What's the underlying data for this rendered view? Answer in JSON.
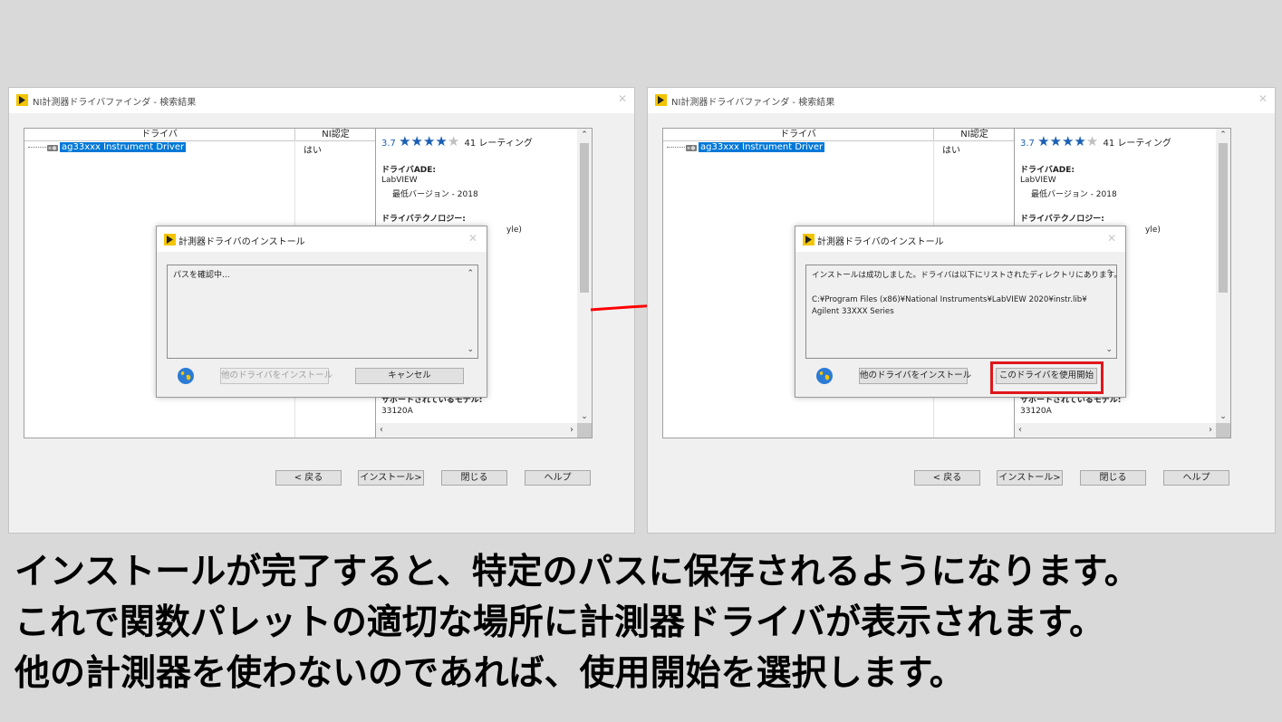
{
  "left_window": {
    "title": "NI計測器ドライバファインダ - 検索結果",
    "close_glyph": "✕",
    "list": {
      "col_driver": "ドライバ",
      "col_ni": "NI認定",
      "row_name": "ag33xxx Instrument Driver",
      "row_ni": "はい"
    },
    "details": {
      "rating_value": "3.7",
      "stars_filled": "★★★★",
      "stars_empty": "★",
      "rating_count": "41 レーティング",
      "ade_label": "ドライバADE:",
      "ade_value": "LabVIEW",
      "min_version": "最低バージョン - 2018",
      "tech_label": "ドライバテクノロジー:",
      "tech_partial": "yle)",
      "models_label": "サポートされているモデル:",
      "model": "33120A"
    },
    "buttons": {
      "back": "< 戻る",
      "install": "インストール>",
      "close": "閉じる",
      "help": "ヘルプ"
    },
    "dialog": {
      "title": "計測器ドライバのインストール",
      "message": "パスを確認中...",
      "other_button": "他のドライバをインストール",
      "cancel_button": "キャンセル"
    }
  },
  "right_window": {
    "title": "NI計測器ドライバファインダ - 検索結果",
    "close_glyph": "✕",
    "list": {
      "col_driver": "ドライバ",
      "col_ni": "NI認定",
      "row_name": "ag33xxx Instrument Driver",
      "row_ni": "はい"
    },
    "details": {
      "rating_value": "3.7",
      "stars_filled": "★★★★",
      "stars_empty": "★",
      "rating_count": "41 レーティング",
      "ade_label": "ドライバADE:",
      "ade_value": "LabVIEW",
      "min_version": "最低バージョン - 2018",
      "tech_label": "ドライバテクノロジー:",
      "tech_partial": "yle)",
      "models_label": "サポートされているモデル:",
      "model": "33120A"
    },
    "buttons": {
      "back": "< 戻る",
      "install": "インストール>",
      "close": "閉じる",
      "help": "ヘルプ"
    },
    "dialog": {
      "title": "計測器ドライバのインストール",
      "message_line1": "インストールは成功しました。ドライバは以下にリストされたディレクトリにあります。",
      "message_line2": "C:¥Program Files (x86)¥National Instruments¥LabVIEW 2020¥instr.lib¥",
      "message_line3": "Agilent 33XXX Series",
      "other_button": "他のドライバをインストール",
      "use_button": "このドライバを使用開始"
    }
  },
  "caption": {
    "line1": "インストールが完了すると、特定のパスに保存されるようになります。",
    "line2": "これで関数パレットの適切な場所に計測器ドライバが表示されます。",
    "line3": "他の計測器を使わないのであれば、使用開始を選択します。"
  },
  "colors": {
    "highlight": "#e0161b",
    "selection": "#0078d7",
    "star": "#1a5fb4"
  }
}
